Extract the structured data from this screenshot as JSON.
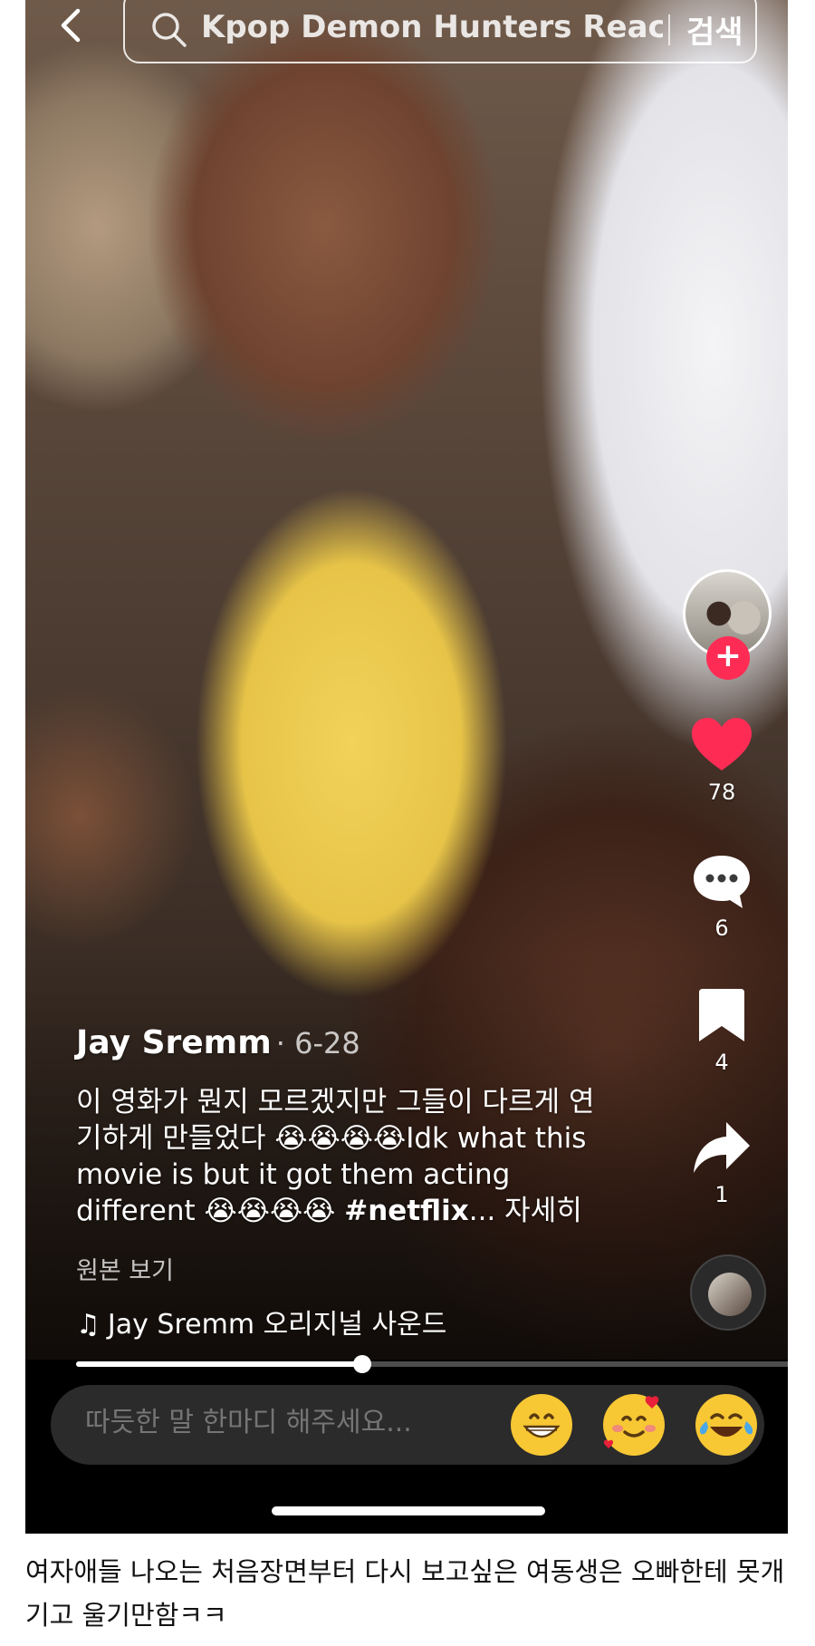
{
  "top_bar": {
    "back_icon": "chevron-left-icon",
    "search_icon": "search-icon",
    "search_query": "Kpop Demon Hunters Reaction",
    "search_button": "검색"
  },
  "video": {
    "author": "Jay Sremm",
    "date": "· 6-28",
    "caption_text": "이 영화가 뭔지 모르겠지만 그들이 다르게 연기하게 만들었다 😭😭😭😭Idk what this movie is but it got them acting different 😭😭😭😭 ",
    "caption_tag": "#netflix",
    "caption_more": "... 자세히",
    "view_original": "원본 보기",
    "sound": "Jay Sremm 오리지널 사운드",
    "progress": 0.4
  },
  "actions": {
    "follow_label": "+",
    "likes": "78",
    "comments": "6",
    "bookmarks": "4",
    "shares": "1",
    "like_color": "#fe2c55"
  },
  "comment_bar": {
    "placeholder": "따듯한 말 한마디 해주세요...",
    "emojis": [
      "😁",
      "🥰",
      "😂"
    ]
  },
  "post": {
    "text": "여자애들 나오는 처음장면부터 다시 보고싶은 여동생은 오빠한테 못개기고 울기만함ㅋㅋ"
  }
}
